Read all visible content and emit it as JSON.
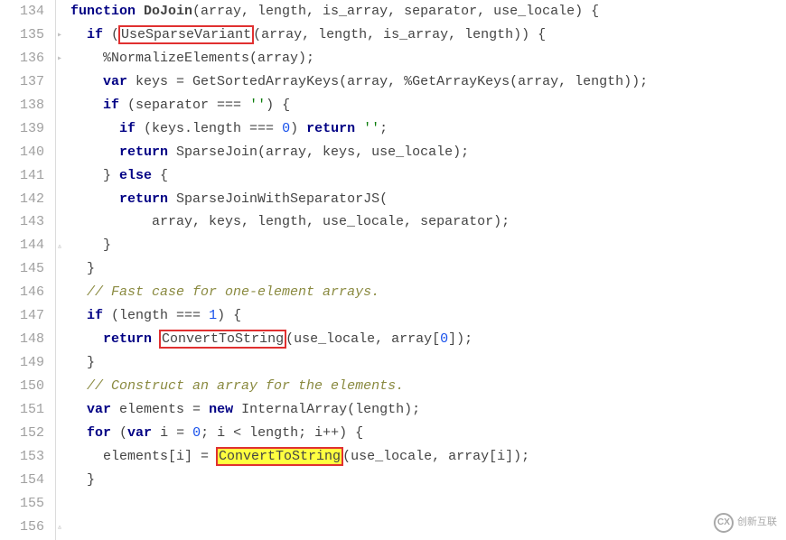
{
  "lines": [
    {
      "n": 134,
      "tokens": [
        {
          "t": "function ",
          "c": "kw"
        },
        {
          "t": "DoJoin",
          "c": "fn-name"
        },
        {
          "t": "(array, length, is_array, separator, use_locale) {"
        }
      ]
    },
    {
      "n": 135,
      "fold": "▸",
      "tokens": [
        {
          "t": "  "
        },
        {
          "t": "if",
          "c": "kw"
        },
        {
          "t": " ("
        },
        {
          "t": "UseSparseVariant",
          "box": "red"
        },
        {
          "t": "(array, length, is_array, length)) {"
        }
      ]
    },
    {
      "n": 136,
      "fold": "▸",
      "tokens": [
        {
          "t": "    %"
        },
        {
          "t": "NormalizeElements",
          "c": ""
        },
        {
          "t": "(array);"
        }
      ]
    },
    {
      "n": 137,
      "tokens": [
        {
          "t": "    "
        },
        {
          "t": "var",
          "c": "kw"
        },
        {
          "t": " keys = GetSortedArrayKeys(array, %GetArrayKeys(array, length));"
        }
      ]
    },
    {
      "n": 138,
      "tokens": [
        {
          "t": "    "
        },
        {
          "t": "if",
          "c": "kw"
        },
        {
          "t": " (separator === "
        },
        {
          "t": "''",
          "c": "str"
        },
        {
          "t": ") {"
        }
      ]
    },
    {
      "n": 139,
      "tokens": [
        {
          "t": "      "
        },
        {
          "t": "if",
          "c": "kw"
        },
        {
          "t": " (keys.length === "
        },
        {
          "t": "0",
          "c": "num"
        },
        {
          "t": ") "
        },
        {
          "t": "return",
          "c": "kw"
        },
        {
          "t": " "
        },
        {
          "t": "''",
          "c": "str"
        },
        {
          "t": ";"
        }
      ]
    },
    {
      "n": 140,
      "tokens": [
        {
          "t": "      "
        },
        {
          "t": "return",
          "c": "kw"
        },
        {
          "t": " SparseJoin(array, keys, use_locale);"
        }
      ]
    },
    {
      "n": 141,
      "tokens": [
        {
          "t": "    } "
        },
        {
          "t": "else",
          "c": "kw"
        },
        {
          "t": " {"
        }
      ]
    },
    {
      "n": 142,
      "tokens": [
        {
          "t": "      "
        },
        {
          "t": "return",
          "c": "kw"
        },
        {
          "t": " SparseJoinWithSeparatorJS("
        }
      ]
    },
    {
      "n": 143,
      "tokens": [
        {
          "t": "          array, keys, length, use_locale, separator);"
        }
      ]
    },
    {
      "n": 144,
      "fold": "▵",
      "tokens": [
        {
          "t": "    }"
        }
      ]
    },
    {
      "n": 145,
      "tokens": [
        {
          "t": "  }"
        }
      ]
    },
    {
      "n": 146,
      "tokens": [
        {
          "t": ""
        }
      ]
    },
    {
      "n": 147,
      "tokens": [
        {
          "t": "  "
        },
        {
          "t": "// Fast case for one-element arrays.",
          "c": "comment"
        }
      ]
    },
    {
      "n": 148,
      "tokens": [
        {
          "t": "  "
        },
        {
          "t": "if",
          "c": "kw"
        },
        {
          "t": " (length === "
        },
        {
          "t": "1",
          "c": "num"
        },
        {
          "t": ") {"
        }
      ]
    },
    {
      "n": 149,
      "tokens": [
        {
          "t": "    "
        },
        {
          "t": "return",
          "c": "kw"
        },
        {
          "t": " "
        },
        {
          "t": "ConvertToString",
          "box": "red"
        },
        {
          "t": "(use_locale, array["
        },
        {
          "t": "0",
          "c": "num"
        },
        {
          "t": "]);"
        }
      ]
    },
    {
      "n": 150,
      "tokens": [
        {
          "t": "  }"
        }
      ]
    },
    {
      "n": 151,
      "tokens": [
        {
          "t": ""
        }
      ]
    },
    {
      "n": 152,
      "tokens": [
        {
          "t": "  "
        },
        {
          "t": "// Construct an array for the elements.",
          "c": "comment"
        }
      ]
    },
    {
      "n": 153,
      "tokens": [
        {
          "t": "  "
        },
        {
          "t": "var",
          "c": "kw"
        },
        {
          "t": " elements = "
        },
        {
          "t": "new",
          "c": "kw"
        },
        {
          "t": " InternalArray(length);"
        }
      ]
    },
    {
      "n": 154,
      "tokens": [
        {
          "t": "  "
        },
        {
          "t": "for",
          "c": "kw"
        },
        {
          "t": " ("
        },
        {
          "t": "var",
          "c": "kw"
        },
        {
          "t": " i = "
        },
        {
          "t": "0",
          "c": "num"
        },
        {
          "t": "; i < length; i++) {"
        }
      ]
    },
    {
      "n": 155,
      "tokens": [
        {
          "t": "    elements[i] = "
        },
        {
          "t": "ConvertToString",
          "box": "yellow"
        },
        {
          "t": "(use_locale, array[i]);"
        }
      ]
    },
    {
      "n": 156,
      "fold": "▵",
      "tokens": [
        {
          "t": "  }"
        }
      ]
    }
  ],
  "watermark": {
    "text": "创新互联",
    "icon": "CX"
  }
}
